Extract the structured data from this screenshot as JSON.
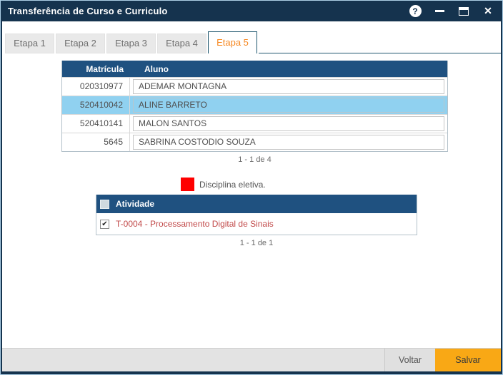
{
  "window": {
    "title": "Transferência de Curso e Curriculo",
    "help_glyph": "?",
    "close_glyph": "✕"
  },
  "tabs": [
    {
      "label": "Etapa 1",
      "active": false
    },
    {
      "label": "Etapa 2",
      "active": false
    },
    {
      "label": "Etapa 3",
      "active": false
    },
    {
      "label": "Etapa 4",
      "active": false
    },
    {
      "label": "Etapa 5",
      "active": true
    }
  ],
  "student_table": {
    "columns": {
      "matricula": "Matrícula",
      "aluno": "Aluno"
    },
    "rows": [
      {
        "matricula": "020310977",
        "aluno": "ADEMAR MONTAGNA",
        "selected": false
      },
      {
        "matricula": "520410042",
        "aluno": "ALINE BARRETO",
        "selected": true
      },
      {
        "matricula": "520410141",
        "aluno": "MALON SANTOS",
        "selected": false
      },
      {
        "matricula": "5645",
        "aluno": "SABRINA COSTODIO SOUZA",
        "selected": false
      }
    ],
    "pagination": "1 - 1 de 4"
  },
  "legend": {
    "color": "#FE0000",
    "label": "Disciplina eletiva."
  },
  "activity_table": {
    "header": "Atividade",
    "rows": [
      {
        "label": "T-0004 - Processamento Digital de Sinais",
        "checked": true,
        "check_glyph": "✔"
      }
    ],
    "pagination": "1 - 1 de 1"
  },
  "footer": {
    "back_label": "Voltar",
    "save_label": "Salvar"
  },
  "colors": {
    "titlebar": "#15334E",
    "table_header": "#1F5180",
    "tab_border": "#1F576E",
    "active_tab_text": "#F6871F",
    "selected_row": "#90D1F0",
    "save_button": "#F9A815",
    "elective_red": "#FE0000",
    "activity_text": "#C14949"
  }
}
